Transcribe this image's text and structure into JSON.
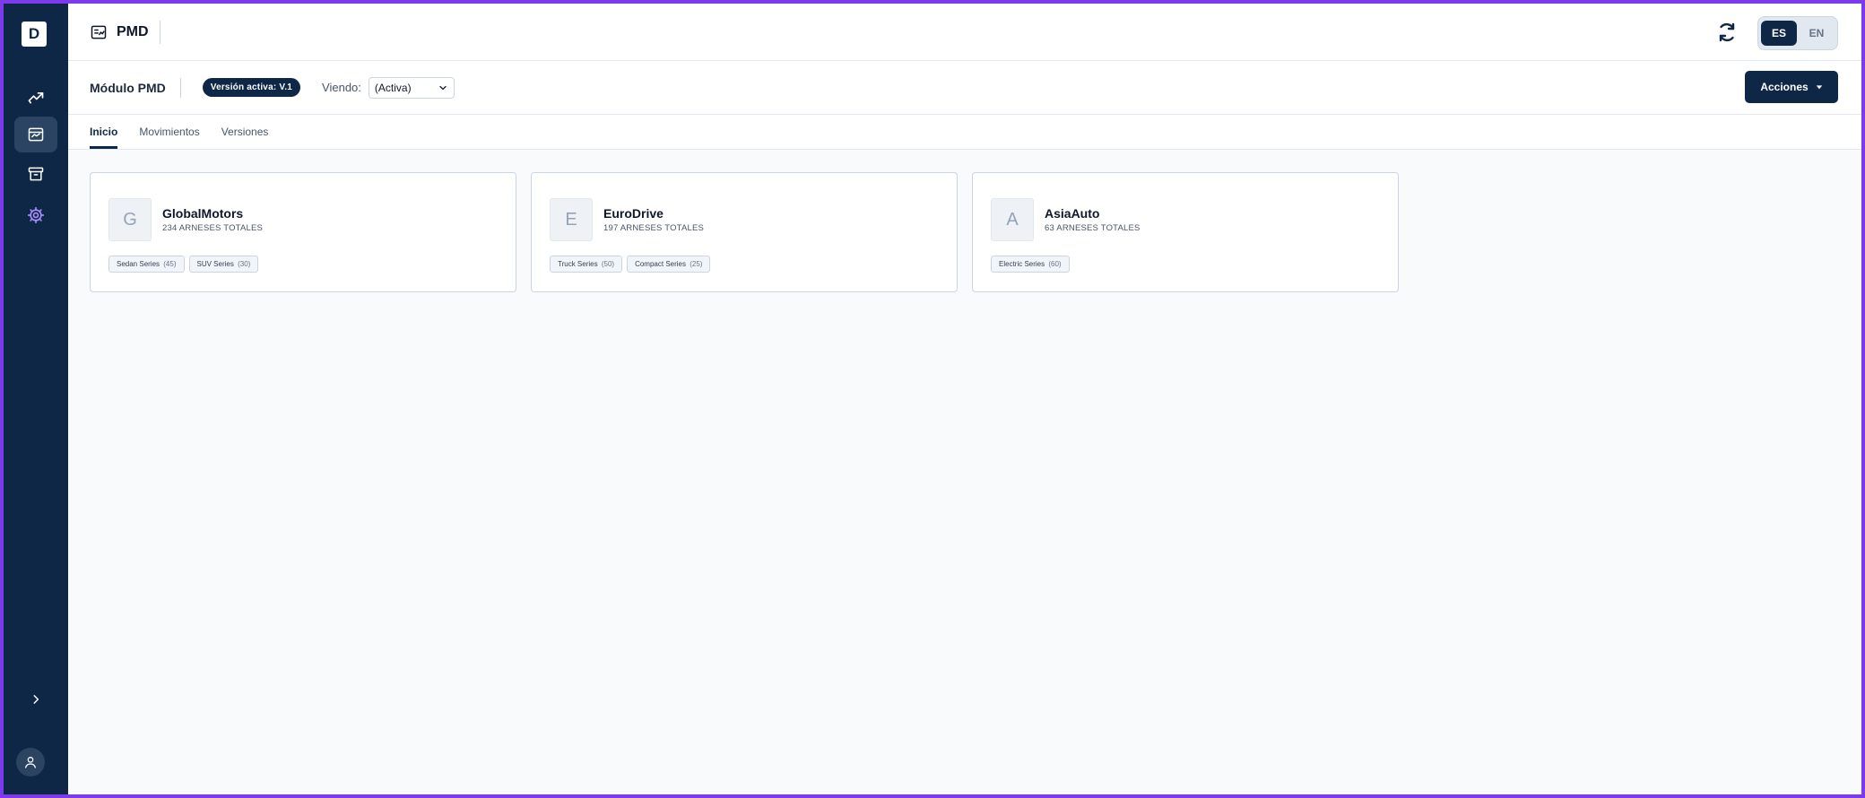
{
  "sidebar": {
    "logo_letter": "D",
    "items": [
      {
        "name": "analytics",
        "icon": "trending-icon"
      },
      {
        "name": "pmd",
        "icon": "dashboard-card-icon",
        "active": true
      },
      {
        "name": "archive",
        "icon": "archive-icon"
      },
      {
        "name": "settings",
        "icon": "gear-icon",
        "color": "#a78bfa"
      }
    ],
    "expand_icon": "chevron-right-icon",
    "user_icon": "user-icon"
  },
  "topbar": {
    "app_name": "PMD",
    "app_icon": "dashboard-card-icon",
    "refresh_icon": "refresh-icon",
    "languages": [
      "ES",
      "EN"
    ],
    "selected_language": "ES"
  },
  "subbar": {
    "title": "Módulo PMD",
    "version_badge": "Versión activa: V.1",
    "viewing_label": "Viendo:",
    "viewing_value": "(Activa)",
    "actions_label": "Acciones"
  },
  "tabs": [
    {
      "label": "Inicio",
      "active": true
    },
    {
      "label": "Movimientos",
      "active": false
    },
    {
      "label": "Versiones",
      "active": false
    }
  ],
  "cards": [
    {
      "initial": "G",
      "name": "GlobalMotors",
      "count_text": "234 ARNESES TOTALES",
      "tags": [
        {
          "label": "Sedan Series",
          "count": "(45)"
        },
        {
          "label": "SUV Series",
          "count": "(30)"
        }
      ]
    },
    {
      "initial": "E",
      "name": "EuroDrive",
      "count_text": "197 ARNESES TOTALES",
      "tags": [
        {
          "label": "Truck Series",
          "count": "(50)"
        },
        {
          "label": "Compact Series",
          "count": "(25)"
        }
      ]
    },
    {
      "initial": "A",
      "name": "AsiaAuto",
      "count_text": "63 ARNESES TOTALES",
      "tags": [
        {
          "label": "Electric Series",
          "count": "(60)"
        }
      ]
    }
  ],
  "colors": {
    "sidebar_bg": "#0f2746",
    "accent": "#0f2746",
    "frame_border": "#7c3aed",
    "page_bg": "#f8fafc"
  }
}
